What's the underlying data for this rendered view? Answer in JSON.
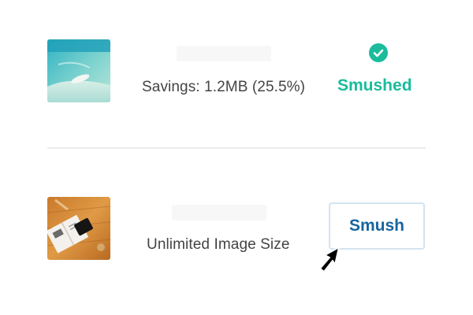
{
  "rows": [
    {
      "thumbnail_icon": "beach-photo-thumbnail",
      "meta_text": "Savings: 1.2MB (25.5%)",
      "status": {
        "icon": "check-circle-icon",
        "label": "Smushed",
        "color": "#1abc9c"
      }
    },
    {
      "thumbnail_icon": "desk-photo-thumbnail",
      "meta_text": "Unlimited Image Size",
      "action": {
        "label": "Smush",
        "color": "#17659e"
      }
    }
  ],
  "cursor_icon": "arrow-pointer-icon"
}
